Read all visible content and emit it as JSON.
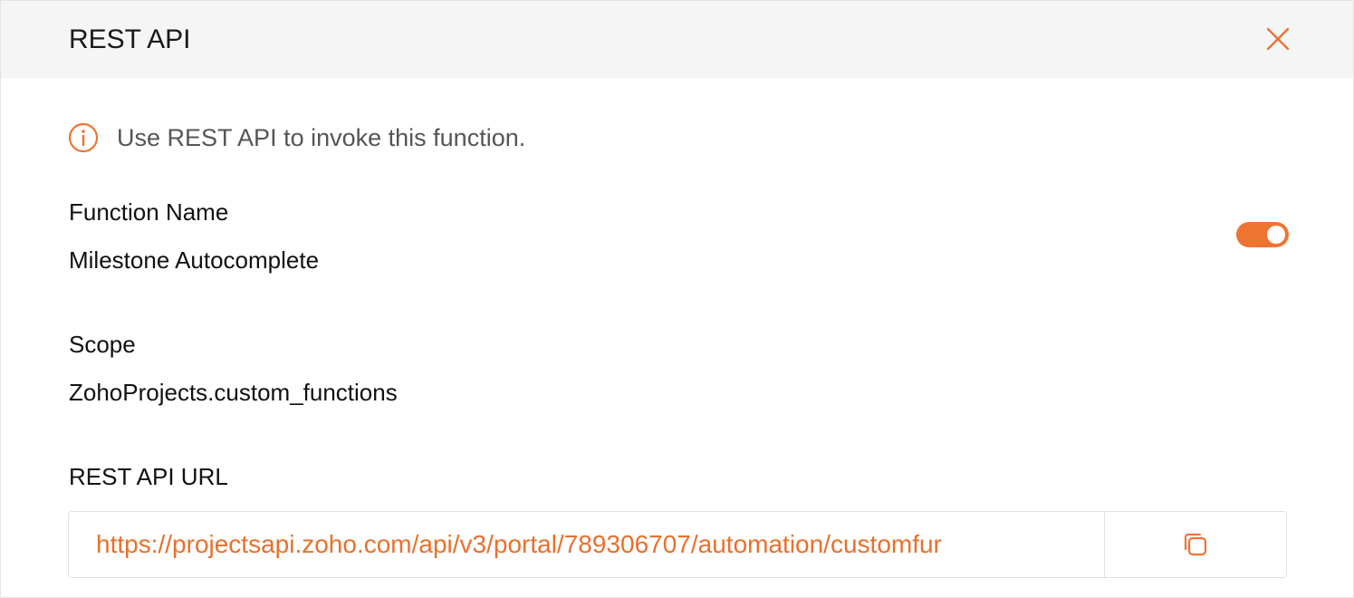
{
  "dialog": {
    "title": "REST API"
  },
  "info": {
    "message": "Use REST API to invoke this function."
  },
  "function_name": {
    "label": "Function Name",
    "value": "Milestone Autocomplete",
    "enabled": true
  },
  "scope": {
    "label": "Scope",
    "value": "ZohoProjects.custom_functions"
  },
  "rest_api_url": {
    "label": "REST API URL",
    "value": "https://projectsapi.zoho.com/api/v3/portal/789306707/automation/customfur"
  },
  "icons": {
    "close": "close-icon",
    "info": "info-icon",
    "copy": "copy-icon"
  },
  "colors": {
    "accent": "#ee7432",
    "header_bg": "#f5f5f5",
    "url_text": "#e8702d"
  }
}
